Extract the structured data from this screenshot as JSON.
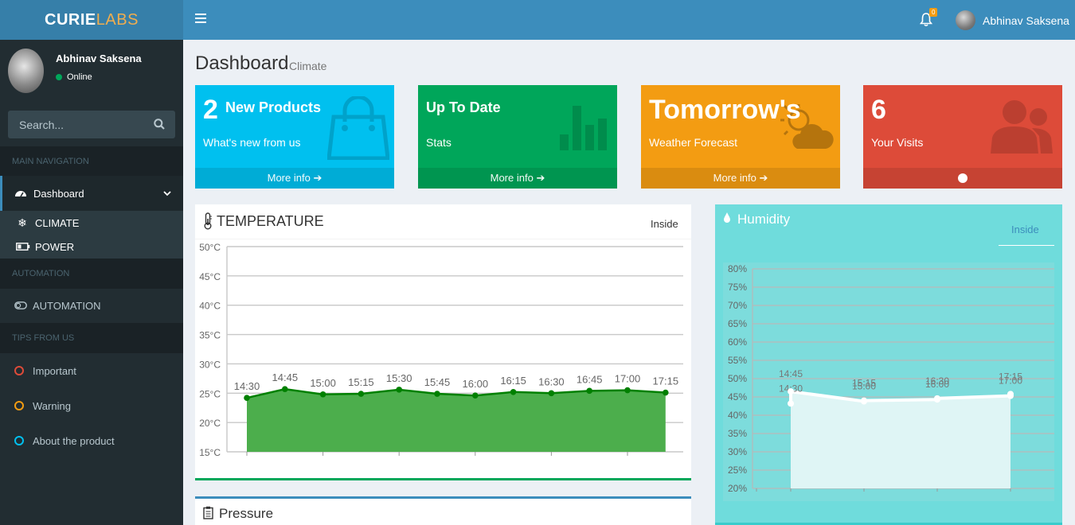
{
  "brand": {
    "part1": "CURIE",
    "part2": "LABS"
  },
  "header": {
    "notification_count": "0",
    "user_name": "Abhinav Saksena"
  },
  "sidebar": {
    "user_name": "Abhinav Saksena",
    "status": "Online",
    "search_placeholder": "Search...",
    "section_main": "MAIN NAVIGATION",
    "dashboard_label": "Dashboard",
    "climate_label": "CLIMATE",
    "power_label": "POWER",
    "section_automation": "AUTOMATION",
    "automation_label": "AUTOMATION",
    "section_tips": "TIPS FROM US",
    "tips": [
      {
        "label": "Important",
        "color": "#dd4b39"
      },
      {
        "label": "Warning",
        "color": "#f39c12"
      },
      {
        "label": "About the product",
        "color": "#00c0ef"
      }
    ]
  },
  "page": {
    "title": "Dashboard",
    "subtitle": "Climate"
  },
  "boxes": [
    {
      "number": "2",
      "title": "New Products",
      "desc": "What's new from us",
      "more": "More info",
      "color": "#00c0ef"
    },
    {
      "title": "Up To Date",
      "desc": "Stats",
      "more": "More info",
      "color": "#00a65a"
    },
    {
      "title": "Tomorrow's",
      "desc": "Weather Forecast",
      "more": "More info",
      "color": "#f39c12"
    },
    {
      "number": "6",
      "desc": "Your Visits",
      "color": "#dd4b39"
    }
  ],
  "temperature": {
    "title": "TEMPERATURE",
    "tab": "Inside",
    "accent": "#00a65a"
  },
  "humidity": {
    "title": "Humidity",
    "tab": "Inside",
    "accent": "#39cccc"
  },
  "pressure": {
    "title": "Pressure"
  },
  "chart_data": [
    {
      "type": "area",
      "title": "TEMPERATURE",
      "ylim": [
        15,
        50
      ],
      "y_ticks": [
        "50°C",
        "45°C",
        "40°C",
        "35°C",
        "30°C",
        "25°C",
        "20°C",
        "15°C"
      ],
      "y_tick_values": [
        50,
        45,
        40,
        35,
        30,
        25,
        20,
        15
      ],
      "categories": [
        "14:30",
        "14:45",
        "15:00",
        "15:15",
        "15:30",
        "15:45",
        "16:00",
        "16:15",
        "16:30",
        "16:45",
        "17:00",
        "17:15"
      ],
      "values": [
        24.2,
        25.7,
        24.8,
        24.9,
        25.6,
        24.9,
        24.6,
        25.2,
        25.0,
        25.4,
        25.5,
        25.1
      ],
      "color": "#008000",
      "fill": "#4cae4c",
      "grid": true
    },
    {
      "type": "area",
      "title": "Humidity",
      "ylim": [
        20,
        80
      ],
      "y_ticks": [
        "80%",
        "75%",
        "70%",
        "65%",
        "60%",
        "55%",
        "50%",
        "45%",
        "40%",
        "35%",
        "30%",
        "25%",
        "20%"
      ],
      "y_tick_values": [
        80,
        75,
        70,
        65,
        60,
        55,
        50,
        45,
        40,
        35,
        30,
        25,
        20
      ],
      "points": [
        {
          "slot": 0,
          "label": "14:30",
          "value": 43.2
        },
        {
          "slot": 0,
          "label": "14:45",
          "value": 46.5
        },
        {
          "slot": 1,
          "label": "15:00",
          "value": 43.8
        },
        {
          "slot": 1,
          "label": "15:15",
          "value": 44.0
        },
        {
          "slot": 2,
          "label": "16:00",
          "value": 44.3
        },
        {
          "slot": 2,
          "label": "16:30",
          "value": 44.6
        },
        {
          "slot": 3,
          "label": "17:00",
          "value": 45.3
        },
        {
          "slot": 3,
          "label": "17:15",
          "value": 45.8
        }
      ],
      "color": "#ffffff",
      "grid": true
    }
  ]
}
